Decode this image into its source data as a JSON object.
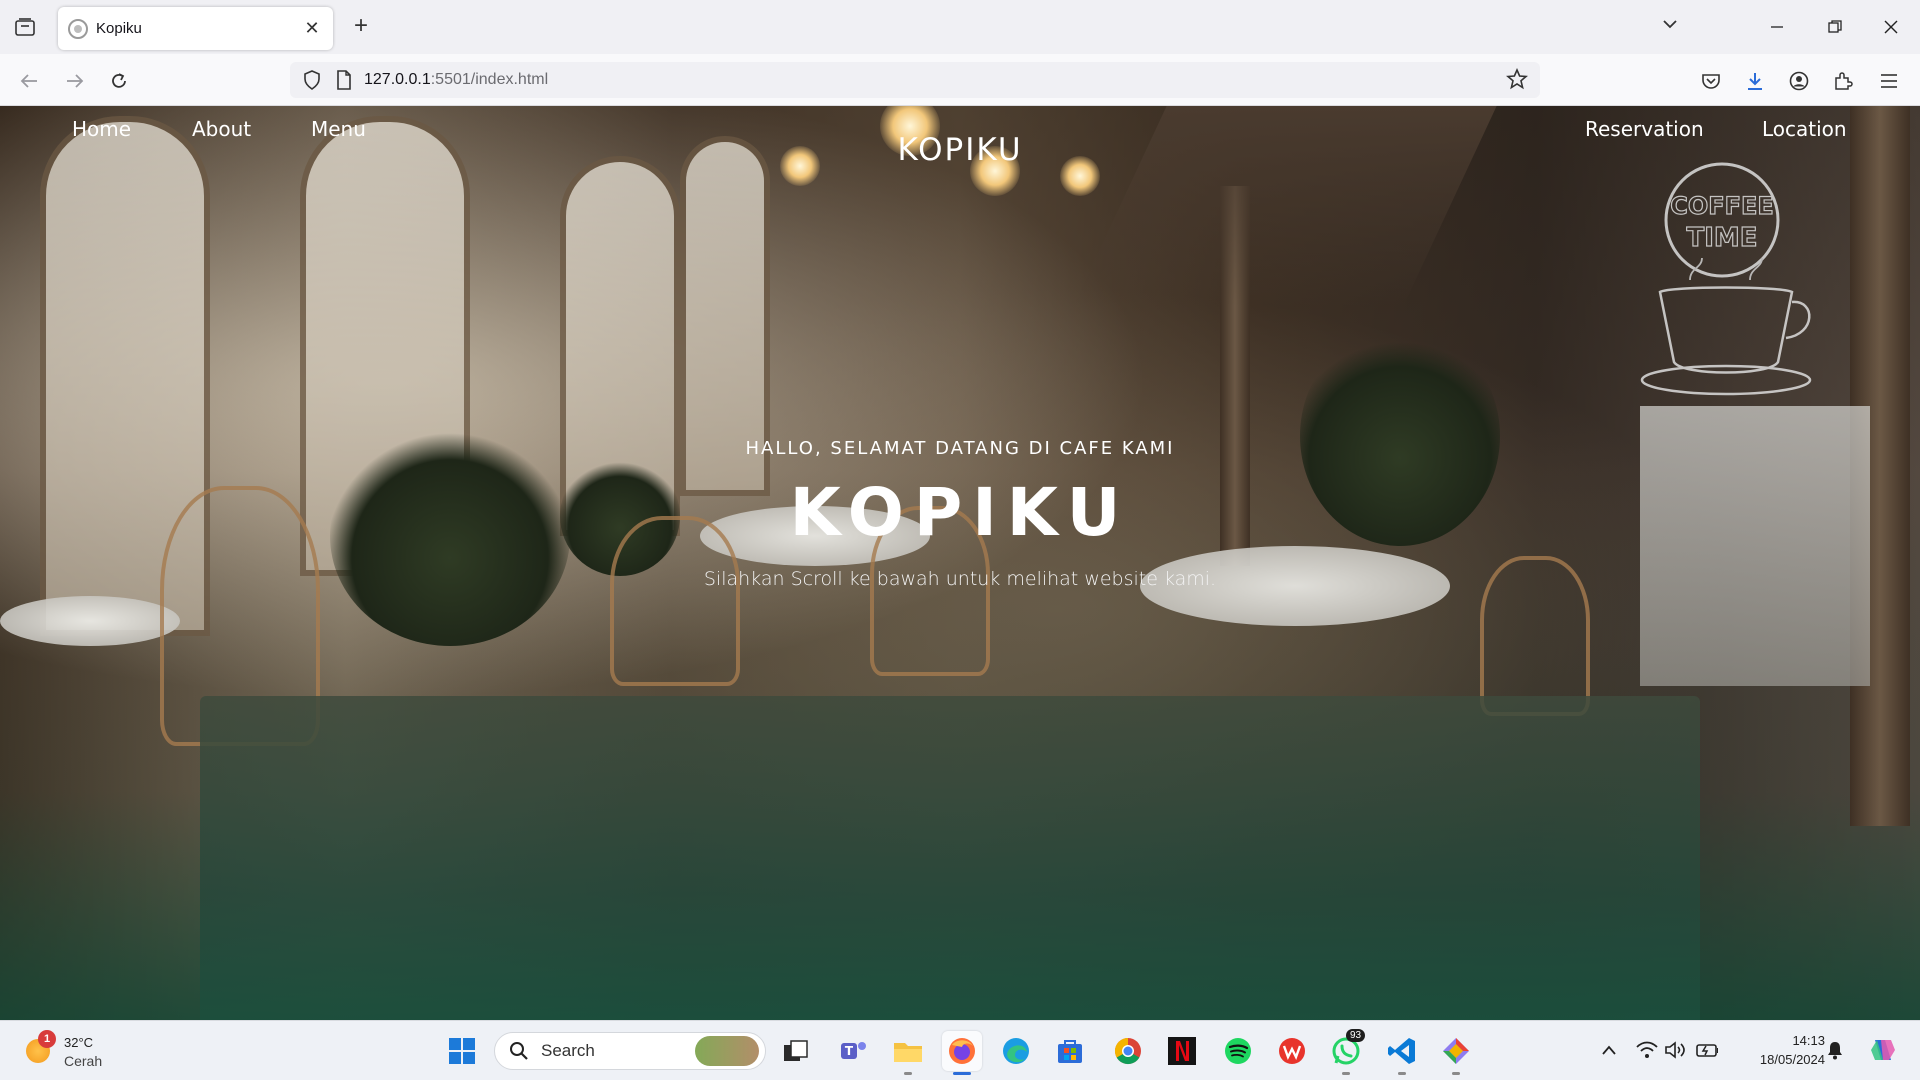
{
  "browser": {
    "tab_title": "Kopiku",
    "url_host": "127.0.0.1",
    "url_rest": ":5501/index.html"
  },
  "site": {
    "nav_left": [
      "Home",
      "About",
      "Menu"
    ],
    "brand": "KOPIKU",
    "nav_right": [
      "Reservation",
      "Location"
    ],
    "hero_subtitle": "HALLO, SELAMAT DATANG DI CAFE KAMI",
    "hero_title": "KOPIKU",
    "hero_description": "Silahkan Scroll ke bawah untuk melihat website kami.",
    "badge_text": [
      "COFFEE",
      "TIME"
    ]
  },
  "taskbar": {
    "weather_temp": "32°C",
    "weather_cond": "Cerah",
    "weather_alert": "1",
    "search_label": "Search",
    "whatsapp_badge": "93",
    "time": "14:13",
    "date": "18/05/2024"
  },
  "colors": {
    "accent_blue": "#2b6cd8",
    "footer_green": "#1b4f3d"
  }
}
